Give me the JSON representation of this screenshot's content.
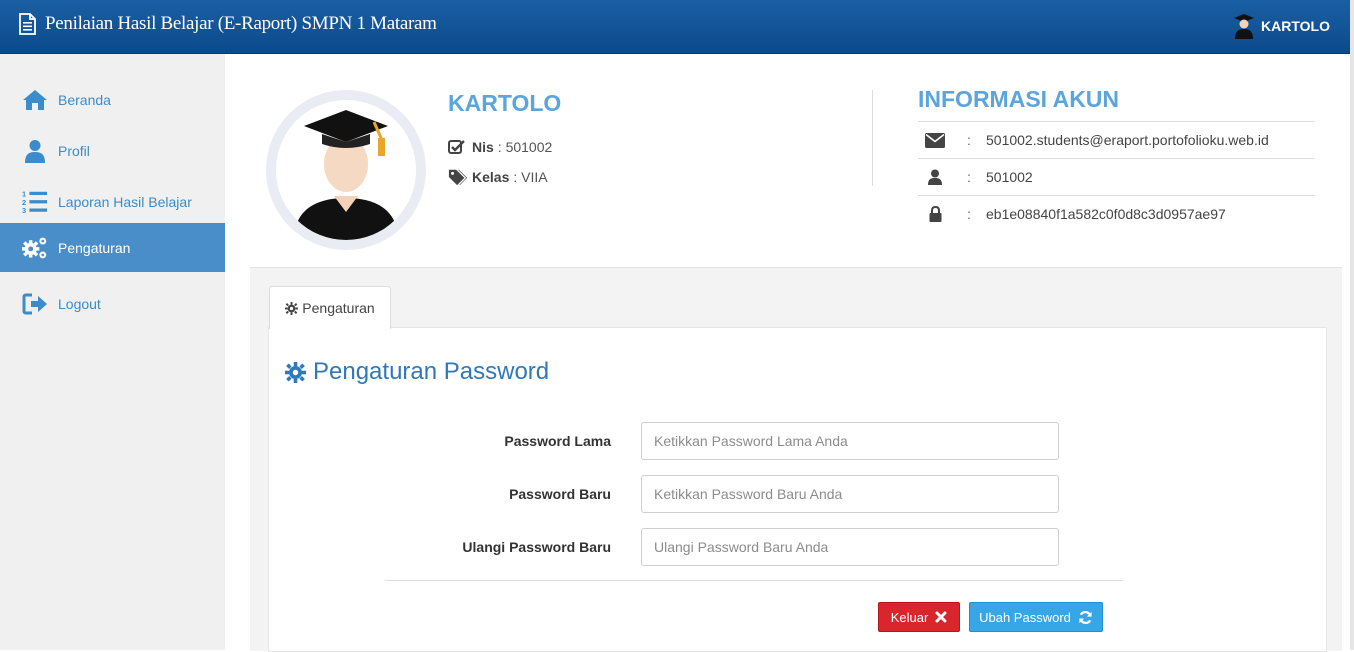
{
  "header": {
    "title": "Penilaian Hasil Belajar (E-Raport) SMPN 1 Mataram",
    "user_name": "KARTOLO"
  },
  "sidebar": {
    "items": [
      {
        "label": "Beranda",
        "icon": "home-icon"
      },
      {
        "label": "Profil",
        "icon": "user-icon"
      },
      {
        "label": "Laporan Hasil Belajar",
        "icon": "ordered-list-icon"
      },
      {
        "label": "Pengaturan",
        "icon": "gears-icon",
        "active": true
      },
      {
        "label": "Logout",
        "icon": "sign-out-icon"
      }
    ]
  },
  "profile": {
    "name": "KARTOLO",
    "nis_label": "Nis",
    "nis_value": ": 501002",
    "kelas_label": "Kelas",
    "kelas_value": ": VIIA"
  },
  "account": {
    "title": "INFORMASI AKUN",
    "rows": [
      {
        "icon": "envelope-icon",
        "colon": ":",
        "value": "501002.students@eraport.portofolioku.web.id"
      },
      {
        "icon": "user-icon",
        "colon": ":",
        "value": "501002"
      },
      {
        "icon": "lock-icon",
        "colon": ":",
        "value": "eb1e08840f1a582c0f0d8c3d0957ae97"
      }
    ]
  },
  "settings": {
    "tab_label": "Pengaturan",
    "section_title": "Pengaturan Password",
    "fields": [
      {
        "label": "Password Lama",
        "placeholder": "Ketikkan Password Lama Anda",
        "value": ""
      },
      {
        "label": "Password Baru",
        "placeholder": "Ketikkan Password Baru Anda",
        "value": ""
      },
      {
        "label": "Ulangi Password Baru",
        "placeholder": "Ulangi Password Baru Anda",
        "value": ""
      }
    ],
    "cancel_label": "Keluar",
    "submit_label": "Ubah Password"
  },
  "colors": {
    "header_bg": "#0e4f93",
    "sidebar_active": "#4a8ec9",
    "accent_text": "#5aa5de",
    "danger": "#d9262c",
    "primary": "#37a6e6"
  }
}
